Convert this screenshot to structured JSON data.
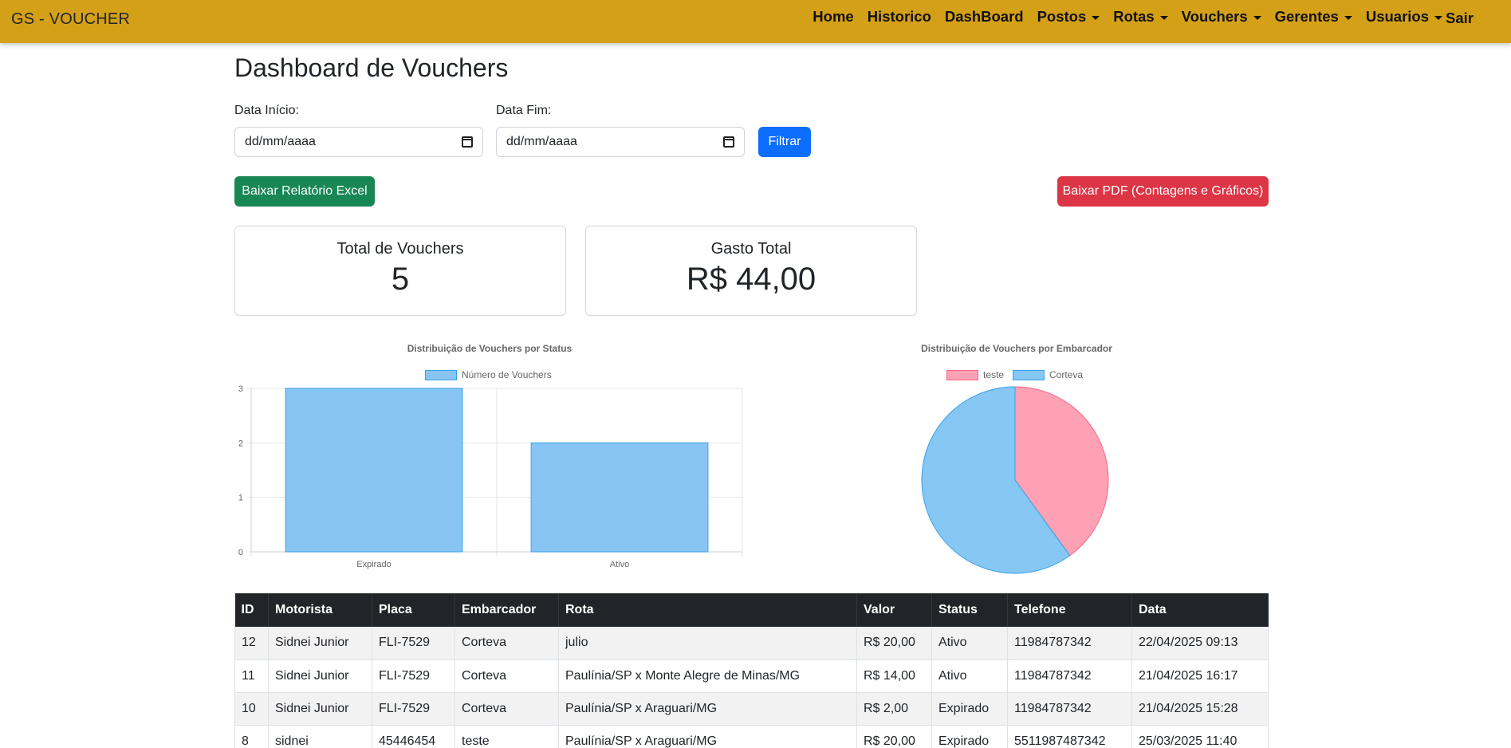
{
  "nav": {
    "brand": "GS - VOUCHER",
    "links": [
      {
        "label": "Home",
        "dropdown": false
      },
      {
        "label": "Historico",
        "dropdown": false
      },
      {
        "label": "DashBoard",
        "dropdown": false
      },
      {
        "label": "Postos",
        "dropdown": true
      },
      {
        "label": "Rotas",
        "dropdown": true
      },
      {
        "label": "Vouchers",
        "dropdown": true
      },
      {
        "label": "Gerentes",
        "dropdown": true
      },
      {
        "label": "Usuarios",
        "dropdown": true
      }
    ],
    "logout": "Sair"
  },
  "page": {
    "title": "Dashboard de Vouchers"
  },
  "filters": {
    "start_label": "Data Início:",
    "start_placeholder": "dd/mm/aaaa",
    "end_label": "Data Fim:",
    "end_placeholder": "dd/mm/aaaa",
    "filter_button": "Filtrar"
  },
  "actions": {
    "excel_button": "Baixar Relatório Excel",
    "pdf_button": "Baixar PDF (Contagens e Gráficos)"
  },
  "cards": {
    "total_title": "Total de Vouchers",
    "total_value": "5",
    "spent_title": "Gasto Total",
    "spent_value": "R$ 44,00"
  },
  "chart_data": [
    {
      "type": "bar",
      "title": "Distribuição de Vouchers por Status",
      "categories": [
        "Expirado",
        "Ativo"
      ],
      "series": [
        {
          "name": "Número de Vouchers",
          "values": [
            3,
            2
          ],
          "color": "#89c5f3"
        }
      ],
      "ylim": [
        0,
        3
      ],
      "yticks": [
        "0",
        "1",
        "2",
        "3"
      ],
      "grid": true,
      "legend": "top"
    },
    {
      "type": "pie",
      "title": "Distribuição de Vouchers por Embarcador",
      "labels": [
        "teste",
        "Corteva"
      ],
      "values": [
        2,
        3
      ],
      "colors": [
        "#ffa1b5",
        "#86c7f3"
      ],
      "legend": "top"
    }
  ],
  "table": {
    "columns": [
      "ID",
      "Motorista",
      "Placa",
      "Embarcador",
      "Rota",
      "Valor",
      "Status",
      "Telefone",
      "Data"
    ],
    "rows": [
      [
        "12",
        "Sidnei Junior",
        "FLI-7529",
        "Corteva",
        "julio",
        "R$ 20,00",
        "Ativo",
        "11984787342",
        "22/04/2025 09:13"
      ],
      [
        "11",
        "Sidnei Junior",
        "FLI-7529",
        "Corteva",
        "Paulínia/SP x Monte Alegre de Minas/MG",
        "R$ 14,00",
        "Ativo",
        "11984787342",
        "21/04/2025 16:17"
      ],
      [
        "10",
        "Sidnei Junior",
        "FLI-7529",
        "Corteva",
        "Paulínia/SP x Araguari/MG",
        "R$ 2,00",
        "Expirado",
        "11984787342",
        "21/04/2025 15:28"
      ],
      [
        "8",
        "sidnei",
        "45446454",
        "teste",
        "Paulínia/SP x Araguari/MG",
        "R$ 20,00",
        "Expirado",
        "5511987487342",
        "25/03/2025 11:40"
      ]
    ]
  }
}
